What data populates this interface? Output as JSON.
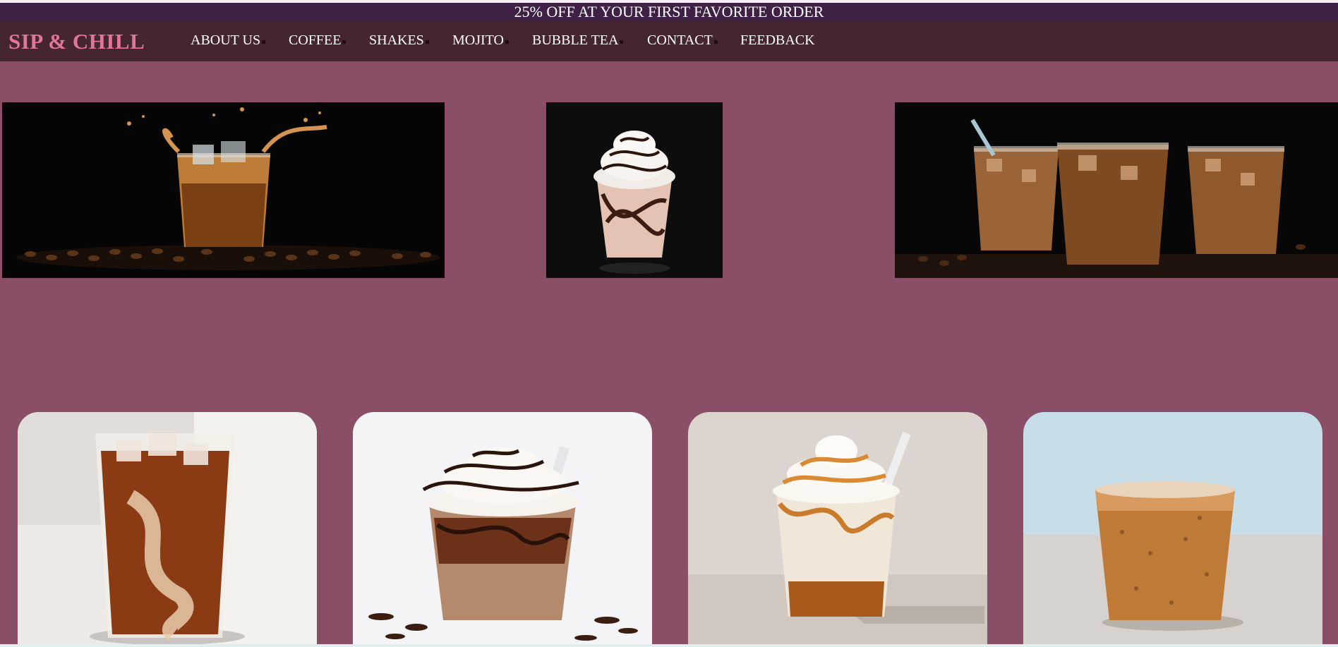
{
  "promo": {
    "text": "25% OFF AT YOUR FIRST FAVORITE ORDER"
  },
  "brand": {
    "name": "SIP & CHILL"
  },
  "nav": {
    "items": [
      {
        "label": "ABOUT US"
      },
      {
        "label": "COFFEE"
      },
      {
        "label": "SHAKES"
      },
      {
        "label": "MOJITO"
      },
      {
        "label": "BUBBLE TEA"
      },
      {
        "label": "CONTACT"
      },
      {
        "label": "FEEDBACK"
      }
    ]
  },
  "colors": {
    "promo_bg": "#3e2144",
    "nav_bg": "#442530",
    "brand": "#e0779a",
    "page_bg": "#8b4e67"
  },
  "hero_images": [
    {
      "icon": "iced-coffee-splash-image"
    },
    {
      "icon": "chocolate-milkshake-image"
    },
    {
      "icon": "three-iced-coffees-image"
    }
  ],
  "product_cards": [
    {
      "icon": "iced-coffee-glass-image"
    },
    {
      "icon": "mocha-frappe-image"
    },
    {
      "icon": "caramel-frappe-image"
    },
    {
      "icon": "iced-latte-cup-image"
    }
  ]
}
